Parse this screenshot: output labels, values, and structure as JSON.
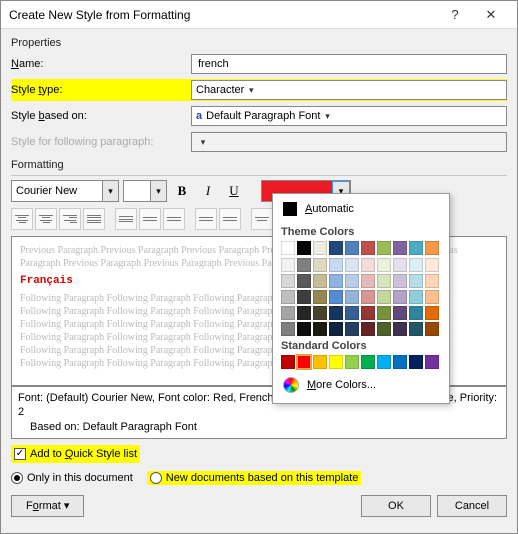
{
  "titlebar": {
    "title": "Create New Style from Formatting",
    "help": "?",
    "close": "✕"
  },
  "sections": {
    "properties": "Properties",
    "formatting": "Formatting"
  },
  "labels": {
    "name": "Name:",
    "style_type": "Style type:",
    "style_based_on": "Style based on:",
    "following": "Style for following paragraph:"
  },
  "fields": {
    "name": "french",
    "style_type": "Character",
    "style_based_on_prefix": "a",
    "style_based_on": "Default Paragraph Font",
    "following": ""
  },
  "formatting": {
    "font_name": "Courier New",
    "font_size": "",
    "color_hex": "#ed1c24"
  },
  "preview": {
    "prev_line": "Previous Paragraph Previous Paragraph Previous Paragraph Previous Paragraph Previous Paragraph Previous",
    "prev_line2": "Paragraph Previous Paragraph Previous Paragraph Previous Paragraph",
    "sample": "Français",
    "follow_line": "Following Paragraph Following Paragraph Following Paragraph Following Paragraph Following Paragraph"
  },
  "description": {
    "line1": "Font: (Default) Courier New, Font color: Red, French (France), Text Fill, Style: Quick Style, Priority: 2",
    "line2": "Based on: Default Paragraph Font"
  },
  "options": {
    "quick_style": "Add to Quick Style list",
    "only_doc": "Only in this document",
    "new_docs": "New documents based on this template"
  },
  "buttons": {
    "format": "Format ▾",
    "ok": "OK",
    "cancel": "Cancel"
  },
  "picker": {
    "automatic": "Automatic",
    "theme_label": "Theme Colors",
    "standard_label": "Standard Colors",
    "more": "More Colors...",
    "theme_row1": [
      "#ffffff",
      "#000000",
      "#eeece1",
      "#1f497d",
      "#4f81bd",
      "#c0504d",
      "#9bbb59",
      "#8064a2",
      "#4bacc6",
      "#f79646"
    ],
    "theme_shades": [
      [
        "#f2f2f2",
        "#7f7f7f",
        "#ddd9c3",
        "#c6d9f0",
        "#dbe5f1",
        "#f2dcdb",
        "#ebf1dd",
        "#e5e0ec",
        "#dbeef3",
        "#fdeada"
      ],
      [
        "#d8d8d8",
        "#595959",
        "#c4bd97",
        "#8db3e2",
        "#b8cce4",
        "#e5b9b7",
        "#d7e3bc",
        "#ccc1d9",
        "#b7dde8",
        "#fbd5b5"
      ],
      [
        "#bfbfbf",
        "#3f3f3f",
        "#938953",
        "#548dd4",
        "#95b3d7",
        "#d99694",
        "#c3d69b",
        "#b2a2c7",
        "#92cddc",
        "#fac08f"
      ],
      [
        "#a5a5a5",
        "#262626",
        "#494429",
        "#17365d",
        "#366092",
        "#953734",
        "#76923c",
        "#5f497a",
        "#31859b",
        "#e36c09"
      ],
      [
        "#7f7f7f",
        "#0c0c0c",
        "#1d1b10",
        "#0f243e",
        "#244061",
        "#632423",
        "#4f6128",
        "#3f3151",
        "#205867",
        "#974806"
      ]
    ],
    "standard": [
      "#c00000",
      "#ff0000",
      "#ffc000",
      "#ffff00",
      "#92d050",
      "#00b050",
      "#00b0f0",
      "#0070c0",
      "#002060",
      "#7030a0"
    ]
  }
}
